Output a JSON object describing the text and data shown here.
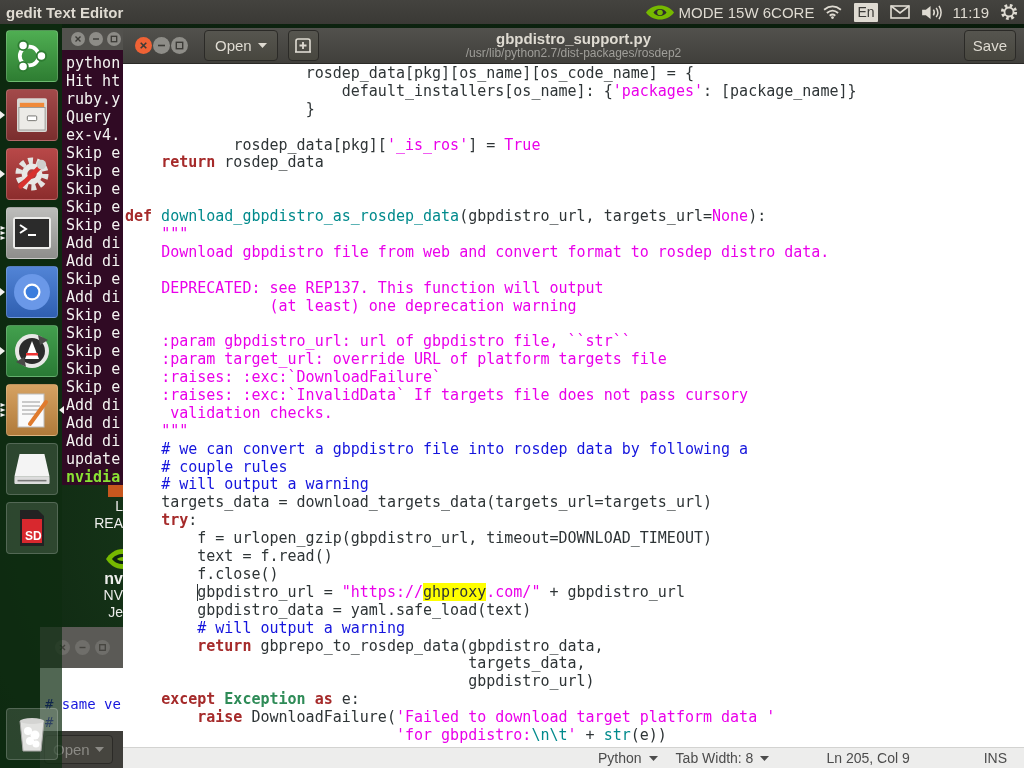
{
  "top_panel": {
    "title": "gedit Text Editor",
    "power_mode": "MODE 15W 6CORE",
    "keyboard_layout": "En",
    "clock": "11:19"
  },
  "launcher": {
    "items": [
      {
        "kind": "dash",
        "running": false,
        "multiple_windows": false,
        "focused": false
      },
      {
        "kind": "files",
        "running": true,
        "multiple_windows": false,
        "focused": false
      },
      {
        "kind": "settings",
        "running": true,
        "multiple_windows": false,
        "focused": false
      },
      {
        "kind": "terminal",
        "running": true,
        "multiple_windows": true,
        "focused": false
      },
      {
        "kind": "browser",
        "running": true,
        "multiple_windows": false,
        "focused": false
      },
      {
        "kind": "updater",
        "running": true,
        "multiple_windows": false,
        "focused": false
      },
      {
        "kind": "editor",
        "running": true,
        "multiple_windows": true,
        "focused": true
      },
      {
        "kind": "drive",
        "running": false,
        "multiple_windows": false,
        "focused": false
      },
      {
        "kind": "sdcard",
        "running": false,
        "multiple_windows": false,
        "focused": false,
        "label": "SD"
      }
    ]
  },
  "terminal": {
    "lines": [
      {
        "text": "python",
        "kind": "output"
      },
      {
        "text": "Hit ht",
        "kind": "output"
      },
      {
        "text": "ruby.y",
        "kind": "output"
      },
      {
        "text": "Query",
        "kind": "output"
      },
      {
        "text": "ex-v4.",
        "kind": "output"
      },
      {
        "text": "Skip e",
        "kind": "output"
      },
      {
        "text": "Skip e",
        "kind": "output"
      },
      {
        "text": "Skip e",
        "kind": "output"
      },
      {
        "text": "Skip e",
        "kind": "output"
      },
      {
        "text": "Skip e",
        "kind": "output"
      },
      {
        "text": "Add di",
        "kind": "output"
      },
      {
        "text": "Add di",
        "kind": "output"
      },
      {
        "text": "Skip e",
        "kind": "output"
      },
      {
        "text": "Add di",
        "kind": "output"
      },
      {
        "text": "Skip e",
        "kind": "output"
      },
      {
        "text": "Skip e",
        "kind": "output"
      },
      {
        "text": "Skip e",
        "kind": "output"
      },
      {
        "text": "Skip e",
        "kind": "output"
      },
      {
        "text": "Skip e",
        "kind": "output"
      },
      {
        "text": "Add di",
        "kind": "output"
      },
      {
        "text": "Add di",
        "kind": "output"
      },
      {
        "text": "Add di",
        "kind": "output"
      },
      {
        "text": "update",
        "kind": "output"
      },
      {
        "text": "nvidia",
        "kind": "prompt"
      }
    ]
  },
  "desktop": {
    "items": [
      {
        "kind": "label",
        "text": "L"
      },
      {
        "kind": "label",
        "text": "REA"
      },
      {
        "kind": "logo",
        "text": "nv"
      },
      {
        "kind": "label",
        "text": "NV"
      },
      {
        "kind": "label",
        "text": "Je"
      }
    ]
  },
  "background_editor": {
    "lines": [
      "# same ve",
      "#"
    ]
  },
  "background_header": {
    "open_button": "Open"
  },
  "window": {
    "title": "gbpdistro_support.py",
    "subtitle": "/usr/lib/python2.7/dist-packages/rosdep2",
    "open_button": "Open",
    "save_button": "Save"
  },
  "editor": {
    "lines": [
      {
        "kind": "code",
        "cursor": false,
        "tokens": [
          {
            "text": "                    rosdep_data[pkg][os_name][os_code_name] = {",
            "kind": "plain"
          }
        ]
      },
      {
        "kind": "code",
        "cursor": false,
        "tokens": [
          {
            "text": "                        default_installers[os_name]: {",
            "kind": "plain"
          },
          {
            "text": "'packages'",
            "kind": "string"
          },
          {
            "text": ": [package_name]}",
            "kind": "plain"
          }
        ]
      },
      {
        "kind": "code",
        "cursor": false,
        "tokens": [
          {
            "text": "                    }",
            "kind": "plain"
          }
        ]
      },
      {
        "kind": "blank"
      },
      {
        "kind": "code",
        "cursor": false,
        "tokens": [
          {
            "text": "            rosdep_data[pkg][",
            "kind": "plain"
          },
          {
            "text": "'_is_ros'",
            "kind": "string"
          },
          {
            "text": "] = ",
            "kind": "plain"
          },
          {
            "text": "True",
            "kind": "constant"
          }
        ]
      },
      {
        "kind": "code",
        "cursor": false,
        "tokens": [
          {
            "text": "    return",
            "kind": "keyword"
          },
          {
            "text": " rosdep_data",
            "kind": "plain"
          }
        ]
      },
      {
        "kind": "blank"
      },
      {
        "kind": "blank"
      },
      {
        "kind": "code",
        "cursor": false,
        "tokens": [
          {
            "text": "def",
            "kind": "keyword"
          },
          {
            "text": " download_gbpdistro_as_rosdep_data",
            "kind": "function"
          },
          {
            "text": "(gbpdistro_url, targets_url=",
            "kind": "plain"
          },
          {
            "text": "None",
            "kind": "constant"
          },
          {
            "text": "):",
            "kind": "plain"
          }
        ]
      },
      {
        "kind": "code",
        "cursor": false,
        "tokens": [
          {
            "text": "    \"\"\"",
            "kind": "string"
          }
        ]
      },
      {
        "kind": "code",
        "cursor": false,
        "tokens": [
          {
            "text": "    Download gbpdistro file from web and convert format to rosdep distro data.",
            "kind": "string"
          }
        ]
      },
      {
        "kind": "blank"
      },
      {
        "kind": "code",
        "cursor": false,
        "tokens": [
          {
            "text": "    DEPRECATED: see REP137. This function will output",
            "kind": "string"
          }
        ]
      },
      {
        "kind": "code",
        "cursor": false,
        "tokens": [
          {
            "text": "                (at least) one deprecation warning",
            "kind": "string"
          }
        ]
      },
      {
        "kind": "blank"
      },
      {
        "kind": "code",
        "cursor": false,
        "tokens": [
          {
            "text": "    :param gbpdistro_url: url of gbpdistro file, ``str``",
            "kind": "string"
          }
        ]
      },
      {
        "kind": "code",
        "cursor": false,
        "tokens": [
          {
            "text": "    :param target_url: override URL of platform targets file",
            "kind": "string"
          }
        ]
      },
      {
        "kind": "code",
        "cursor": false,
        "tokens": [
          {
            "text": "    :raises: :exc:`DownloadFailure`",
            "kind": "string"
          }
        ]
      },
      {
        "kind": "code",
        "cursor": false,
        "tokens": [
          {
            "text": "    :raises: :exc:`InvalidData` If targets file does not pass cursory",
            "kind": "string"
          }
        ]
      },
      {
        "kind": "code",
        "cursor": false,
        "tokens": [
          {
            "text": "     validation checks.",
            "kind": "string"
          }
        ]
      },
      {
        "kind": "code",
        "cursor": false,
        "tokens": [
          {
            "text": "    \"\"\"",
            "kind": "string"
          }
        ]
      },
      {
        "kind": "code",
        "cursor": false,
        "tokens": [
          {
            "text": "    # we can convert a gbpdistro file into rosdep data by following a",
            "kind": "comment"
          }
        ]
      },
      {
        "kind": "code",
        "cursor": false,
        "tokens": [
          {
            "text": "    # couple rules",
            "kind": "comment"
          }
        ]
      },
      {
        "kind": "code",
        "cursor": false,
        "tokens": [
          {
            "text": "    # will output a warning",
            "kind": "comment"
          }
        ]
      },
      {
        "kind": "code",
        "cursor": false,
        "tokens": [
          {
            "text": "    targets_data = download_targets_data(targets_url=targets_url)",
            "kind": "plain"
          }
        ]
      },
      {
        "kind": "code",
        "cursor": false,
        "tokens": [
          {
            "text": "    try",
            "kind": "keyword"
          },
          {
            "text": ":",
            "kind": "plain"
          }
        ]
      },
      {
        "kind": "code",
        "cursor": false,
        "tokens": [
          {
            "text": "        f = urlopen_gzip(gbpdistro_url, timeout=DOWNLOAD_TIMEOUT)",
            "kind": "plain"
          }
        ]
      },
      {
        "kind": "code",
        "cursor": false,
        "tokens": [
          {
            "text": "        text = f.read()",
            "kind": "plain"
          }
        ]
      },
      {
        "kind": "code",
        "cursor": false,
        "tokens": [
          {
            "text": "        f.close()",
            "kind": "plain"
          }
        ]
      },
      {
        "kind": "code",
        "cursor": true,
        "tokens": [
          {
            "text": "        gbpdistro_url = ",
            "kind": "plain"
          },
          {
            "text": "\"https://",
            "kind": "string"
          },
          {
            "text": "ghproxy",
            "kind": "match"
          },
          {
            "text": ".com/\"",
            "kind": "string"
          },
          {
            "text": " + gbpdistro_url",
            "kind": "plain"
          }
        ]
      },
      {
        "kind": "code",
        "cursor": false,
        "tokens": [
          {
            "text": "        gbpdistro_data = yaml.safe_load(text)",
            "kind": "plain"
          }
        ]
      },
      {
        "kind": "code",
        "cursor": false,
        "tokens": [
          {
            "text": "        # will output a warning",
            "kind": "comment"
          }
        ]
      },
      {
        "kind": "code",
        "cursor": false,
        "tokens": [
          {
            "text": "        return",
            "kind": "keyword"
          },
          {
            "text": " gbprepo_to_rosdep_data(gbpdistro_data,",
            "kind": "plain"
          }
        ]
      },
      {
        "kind": "code",
        "cursor": false,
        "tokens": [
          {
            "text": "                                      targets_data,",
            "kind": "plain"
          }
        ]
      },
      {
        "kind": "code",
        "cursor": false,
        "tokens": [
          {
            "text": "                                      gbpdistro_url)",
            "kind": "plain"
          }
        ]
      },
      {
        "kind": "code",
        "cursor": false,
        "tokens": [
          {
            "text": "    except",
            "kind": "keyword"
          },
          {
            "text": " Exception",
            "kind": "class"
          },
          {
            "text": " as",
            "kind": "keyword"
          },
          {
            "text": " e:",
            "kind": "plain"
          }
        ]
      },
      {
        "kind": "code",
        "cursor": false,
        "tokens": [
          {
            "text": "        raise",
            "kind": "keyword"
          },
          {
            "text": " DownloadFailure(",
            "kind": "plain"
          },
          {
            "text": "'Failed to download target platform data '",
            "kind": "string"
          }
        ]
      },
      {
        "kind": "code",
        "cursor": false,
        "tokens": [
          {
            "text": "                              'for gbpdistro:",
            "kind": "string"
          },
          {
            "text": "\\n\\t",
            "kind": "escape"
          },
          {
            "text": "'",
            "kind": "string"
          },
          {
            "text": " + ",
            "kind": "plain"
          },
          {
            "text": "str",
            "kind": "builtin"
          },
          {
            "text": "(e))",
            "kind": "plain"
          }
        ]
      }
    ]
  },
  "status_bar": {
    "language": "Python",
    "tab_width": "Tab Width: 8",
    "position": "Ln 205, Col 9",
    "mode": "INS"
  }
}
